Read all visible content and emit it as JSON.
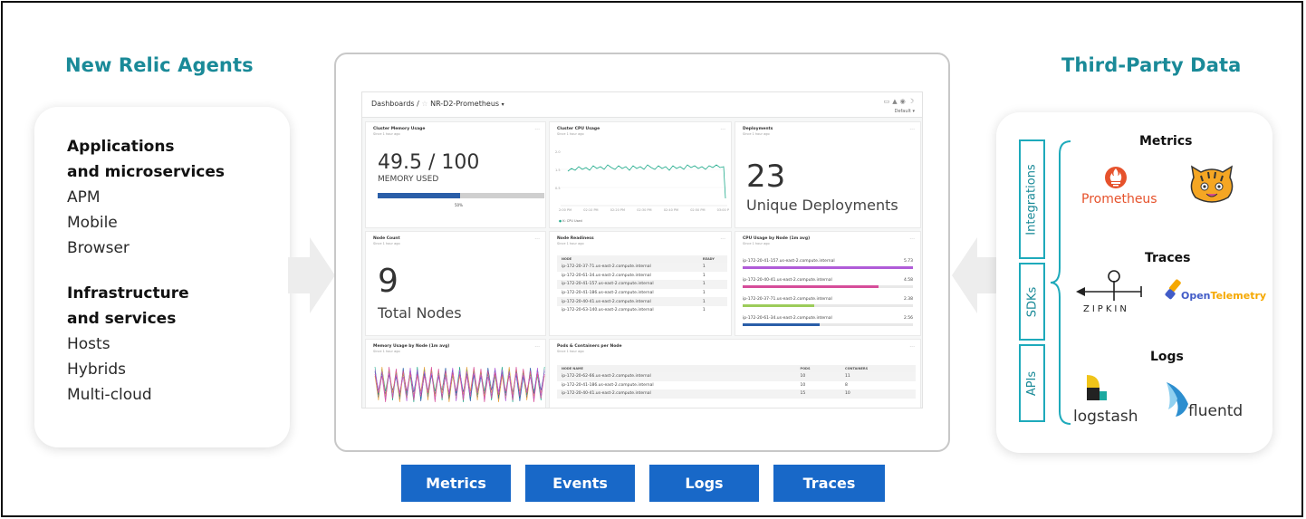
{
  "left": {
    "title": "New Relic Agents",
    "group1_title_line1": "Applications",
    "group1_title_line2": "and microservices",
    "group1_items": [
      "APM",
      "Mobile",
      "Browser"
    ],
    "group2_title_line1": "Infrastructure",
    "group2_title_line2": "and services",
    "group2_items": [
      "Hosts",
      "Hybrids",
      "Multi-cloud"
    ]
  },
  "right": {
    "title": "Third-Party Data",
    "side_labels": [
      "Integrations",
      "SDKs",
      "APIs"
    ],
    "categories": [
      "Metrics",
      "Traces",
      "Logs"
    ],
    "logos": {
      "prometheus": "Prometheus",
      "zipkin": "ZIPKIN",
      "opentelemetry_prefix": "Open",
      "opentelemetry_suffix": "Telemetry",
      "logstash": "logstash",
      "fluentd": "fluentd"
    }
  },
  "dashboard": {
    "breadcrumb_root": "Dashboards /",
    "name": "NR-D2-Prometheus",
    "default_label": "Default",
    "panels": {
      "memory": {
        "title": "Cluster Memory Usage",
        "since": "Since 1 hour ago",
        "value": "49.5 / 100",
        "label": "MEMORY USED",
        "percent_label": "50%",
        "fraction": 0.495
      },
      "cpu": {
        "title": "Cluster CPU Usage",
        "since": "Since 1 hour ago",
        "legend": "K: CPU Used",
        "x_ticks": [
          "2:00 PM",
          "02:10 PM",
          "02:20 PM",
          "02:30 PM",
          "02:40 PM",
          "02:50 PM",
          "03:00 P"
        ]
      },
      "deployments": {
        "title": "Deployments",
        "since": "Since 1 hour ago",
        "value": "23",
        "label": "Unique Deployments"
      },
      "nodes": {
        "title": "Node Count",
        "since": "Since 1 hour ago",
        "value": "9",
        "label": "Total Nodes"
      },
      "readiness": {
        "title": "Node Readiness",
        "since": "Since 1 hour ago",
        "columns": [
          "NODE",
          "READY"
        ],
        "rows": [
          [
            "ip-172-20-37-71.us-east-2.compute.internal",
            "1"
          ],
          [
            "ip-172-20-61-34.us-east-2.compute.internal",
            "1"
          ],
          [
            "ip-172-20-41-157.us-east-2.compute.internal",
            "1"
          ],
          [
            "ip-172-20-41-186.us-east-2.compute.internal",
            "1"
          ],
          [
            "ip-172-20-40-41.us-east-2.compute.internal",
            "1"
          ],
          [
            "ip-172-20-63-140.us-east-2.compute.internal",
            "1"
          ]
        ]
      },
      "cpu_by_node": {
        "title": "CPU Usage by Node (1m avg)",
        "since": "Since 1 hour ago",
        "rows": [
          {
            "node": "ip-172-20-41-157.us-east-2.compute.internal",
            "value": "5.73",
            "color": "#b05cd8",
            "fraction": 1.0
          },
          {
            "node": "ip-172-20-40-41.us-east-2.compute.internal",
            "value": "4.58",
            "color": "#d64d9a",
            "fraction": 0.8
          },
          {
            "node": "ip-172-20-37-71.us-east-2.compute.internal",
            "value": "2.38",
            "color": "#9ccc5a",
            "fraction": 0.42
          },
          {
            "node": "ip-172-20-61-34.us-east-2.compute.internal",
            "value": "2.56",
            "color": "#2a5ea8",
            "fraction": 0.45
          }
        ]
      },
      "memory_by_node": {
        "title": "Memory Usage by Node (1m avg)",
        "since": "Since 1 hour ago"
      },
      "pods": {
        "title": "Pods & Containers per Node",
        "since": "Since 1 hour ago",
        "columns": [
          "NODE NAME",
          "PODS",
          "CONTAINERS"
        ],
        "rows": [
          [
            "ip-172-20-62-66.us-east-2.compute.internal",
            "10",
            "11"
          ],
          [
            "ip-172-20-41-186.us-east-2.compute.internal",
            "10",
            "8"
          ],
          [
            "ip-172-20-40-41.us-east-2.compute.internal",
            "15",
            "10"
          ]
        ]
      }
    }
  },
  "buttons": [
    "Metrics",
    "Events",
    "Logs",
    "Traces"
  ],
  "colors": {
    "heading": "#1a8a98",
    "button": "#1868c8",
    "accent_box": "#1eaabb"
  }
}
